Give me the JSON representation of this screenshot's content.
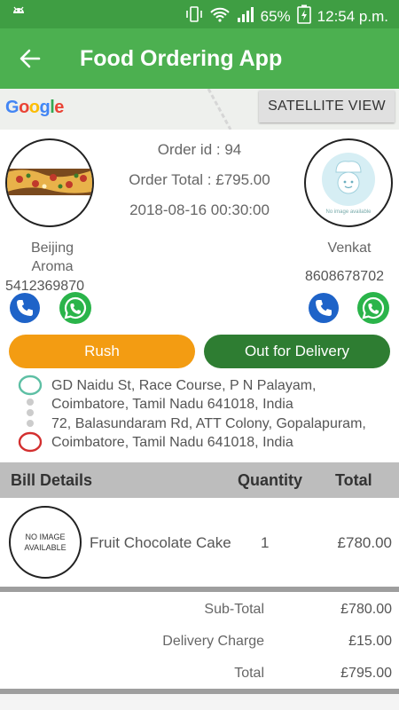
{
  "status_bar": {
    "battery": "65%",
    "time": "12:54 p.m."
  },
  "app_bar": {
    "title": "Food Ordering App"
  },
  "map": {
    "google_text": "Google",
    "satellite_label": "SATELLITE VIEW"
  },
  "order": {
    "id_text": "Order id : 94",
    "total_text": "Order Total : £795.00",
    "datetime": "2018-08-16 00:30:00"
  },
  "restaurant": {
    "name": "Beijing Aroma",
    "phone": "5412369870"
  },
  "customer": {
    "name": "Venkat",
    "phone": "8608678702",
    "avatar_caption": "No image available"
  },
  "actions": {
    "rush_label": "Rush",
    "delivery_label": "Out for Delivery"
  },
  "addresses": {
    "pickup": "GD Naidu St, Race Course, P N Palayam, Coimbatore, Tamil Nadu 641018, India",
    "dropoff": "72, Balasundaram Rd, ATT Colony, Gopalapuram, Coimbatore, Tamil Nadu 641018, India"
  },
  "bill": {
    "headers": {
      "details": "Bill Details",
      "quantity": "Quantity",
      "total": "Total"
    },
    "items": [
      {
        "image_text": "NO IMAGE AVAILABLE",
        "name": "Fruit Chocolate Cake",
        "quantity": "1",
        "total": "£780.00"
      }
    ],
    "summary": {
      "subtotal_label": "Sub-Total",
      "subtotal_value": "£780.00",
      "delivery_label": "Delivery Charge",
      "delivery_value": "£15.00",
      "total_label": "Total",
      "total_value": "£795.00"
    }
  },
  "colors": {
    "app_bar": "#4cb050",
    "status_bar": "#3f9e43",
    "rush": "#f39c12",
    "delivery": "#2e7d32",
    "pickup_ring": "#5dbfa4",
    "dropoff_ring": "#d32f2f"
  }
}
